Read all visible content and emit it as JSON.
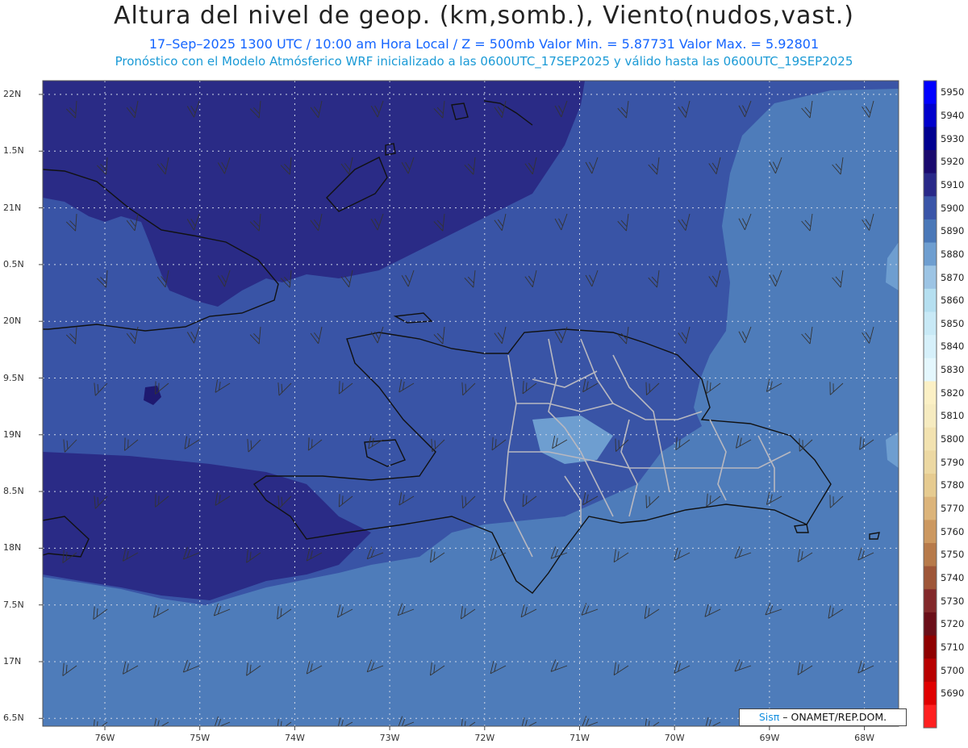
{
  "title": "Altura del nivel de geop. (km,somb.), Viento(nudos,vast.)",
  "subtitle1": "17–Sep–2025 1300 UTC / 10:00 am Hora Local / Z = 500mb    Valor Min. = 5.87731   Valor Max. = 5.92801",
  "subtitle2": "Pronóstico con el Modelo Atmósferico WRF inicializado a las 0600UTC_17SEP2025 y válido hasta las  0600UTC_19SEP2025",
  "map": {
    "lat_labels": [
      "22N",
      "1.5N",
      "21N",
      "0.5N",
      "20N",
      "9.5N",
      "19N",
      "8.5N",
      "18N",
      "7.5N",
      "17N",
      "6.5N"
    ],
    "lon_labels": [
      "76W",
      "75W",
      "74W",
      "73W",
      "72W",
      "71W",
      "70W",
      "69W",
      "68W"
    ],
    "credit": {
      "brand": "Sisπ",
      "org": "– ONAMET/REP.DOM."
    }
  },
  "color_scale": {
    "levels": [
      {
        "value": "5950",
        "color": "#0000ff"
      },
      {
        "value": "5940",
        "color": "#0000cc"
      },
      {
        "value": "5930",
        "color": "#000090"
      },
      {
        "value": "5920",
        "color": "#1a0a6e"
      },
      {
        "value": "5910",
        "color": "#282888"
      },
      {
        "value": "5900",
        "color": "#3a55a8"
      },
      {
        "value": "5890",
        "color": "#4a78b8"
      },
      {
        "value": "5880",
        "color": "#6e9ed0"
      },
      {
        "value": "5870",
        "color": "#9cc4e4"
      },
      {
        "value": "5860",
        "color": "#b5dff0"
      },
      {
        "value": "5850",
        "color": "#c8e9f6"
      },
      {
        "value": "5840",
        "color": "#d6f0fa"
      },
      {
        "value": "5830",
        "color": "#e4f7fd"
      },
      {
        "value": "5820",
        "color": "#fbf0c5"
      },
      {
        "value": "5810",
        "color": "#f6ebc0"
      },
      {
        "value": "5800",
        "color": "#f2e2b0"
      },
      {
        "value": "5790",
        "color": "#ecd8a2"
      },
      {
        "value": "5780",
        "color": "#e6cb90"
      },
      {
        "value": "5770",
        "color": "#dcb47a"
      },
      {
        "value": "5760",
        "color": "#cc9860"
      },
      {
        "value": "5750",
        "color": "#b77a4a"
      },
      {
        "value": "5740",
        "color": "#9e5638"
      },
      {
        "value": "5730",
        "color": "#82282a"
      },
      {
        "value": "5720",
        "color": "#6a0e18"
      },
      {
        "value": "5710",
        "color": "#8e0000"
      },
      {
        "value": "5700",
        "color": "#b80000"
      },
      {
        "value": "5690",
        "color": "#e00000"
      }
    ],
    "bottom_color": "#ff2020"
  }
}
